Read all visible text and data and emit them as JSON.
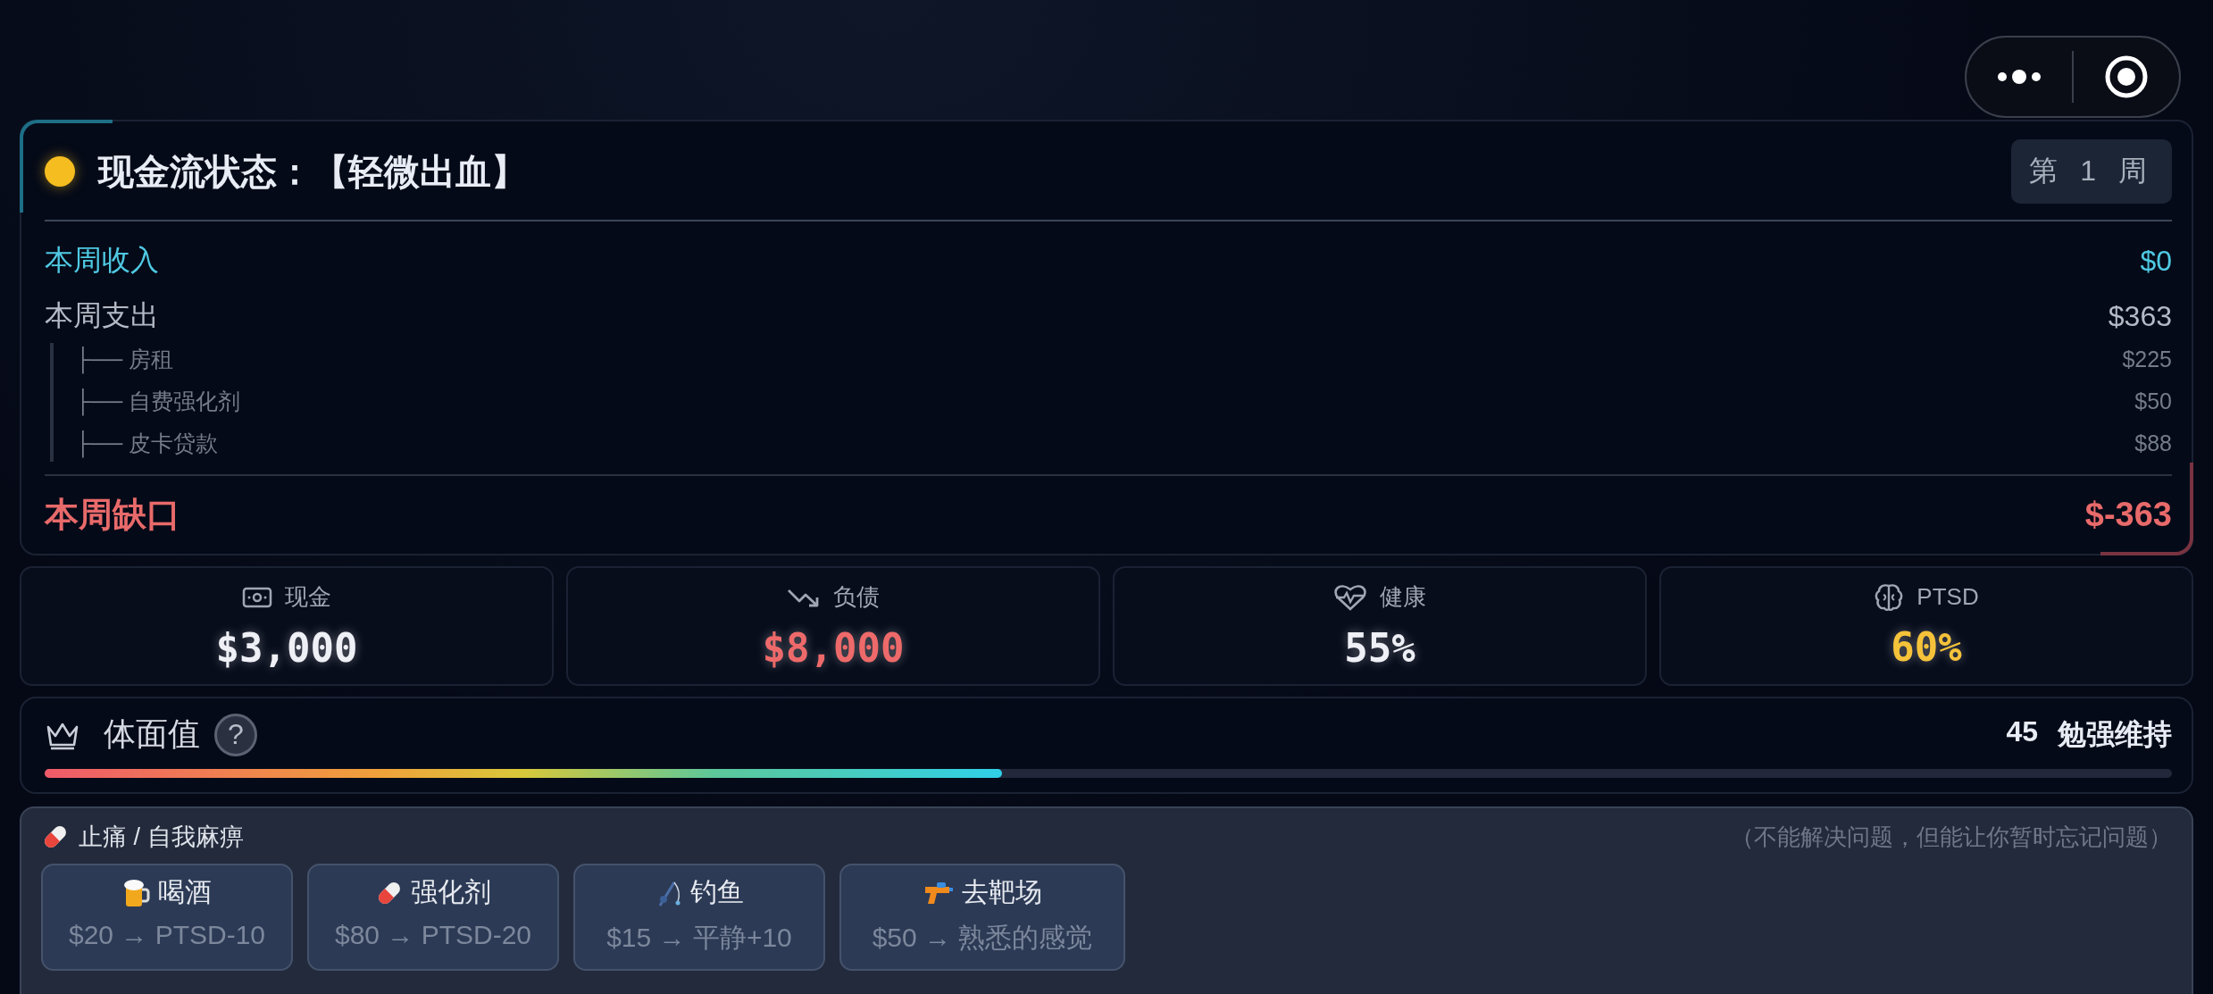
{
  "cashflow": {
    "title": "现金流状态：【轻微出血】",
    "week": "第 1 周",
    "income": {
      "label": "本周收入",
      "value": "$0"
    },
    "expense": {
      "label": "本周支出",
      "value": "$363"
    },
    "expense_items": [
      {
        "label": "├── 房租",
        "value": "$225"
      },
      {
        "label": "├── 自费强化剂",
        "value": "$50"
      },
      {
        "label": "├── 皮卡贷款",
        "value": "$88"
      }
    ],
    "gap": {
      "label": "本周缺口",
      "value": "$-363"
    }
  },
  "stats": [
    {
      "kind": "cash",
      "label": "现金",
      "value": "$3,000",
      "color": "#eef0f6"
    },
    {
      "kind": "debt",
      "label": "负债",
      "value": "$8,000",
      "color": "#ee6a6a"
    },
    {
      "kind": "health",
      "label": "健康",
      "value": "55%",
      "color": "#eef0f6"
    },
    {
      "kind": "brain",
      "label": "PTSD",
      "value": "60%",
      "color": "#f5c23a"
    }
  ],
  "dignity": {
    "title": "体面值",
    "help": "?",
    "score": "45",
    "status": "勉强维持",
    "level": 0.45
  },
  "relief": {
    "title": "止痛 / 自我麻痹",
    "note": "（不能解决问题，但能让你暂时忘记问题）",
    "options": [
      {
        "kind": "beer",
        "name": "喝酒",
        "effect": "$20 → PTSD-10"
      },
      {
        "kind": "pill",
        "name": "强化剂",
        "effect": "$80 → PTSD-20"
      },
      {
        "kind": "fishing",
        "name": "钓鱼",
        "effect": "$15 → 平静+10"
      },
      {
        "kind": "gun",
        "name": "去靶场",
        "effect": "$50 → 熟悉的感觉"
      }
    ]
  }
}
